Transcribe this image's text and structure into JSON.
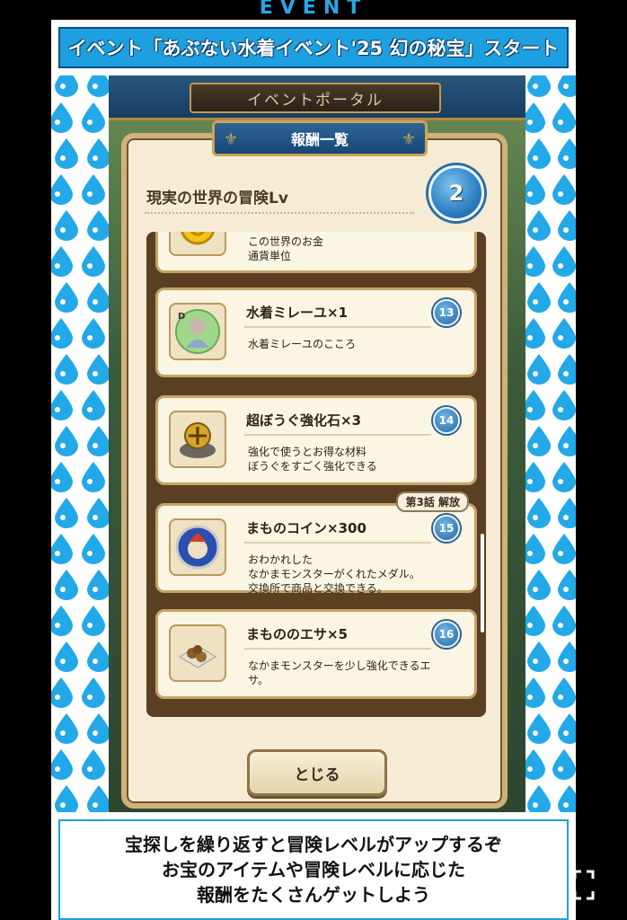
{
  "header": {
    "event_label": "EVENT",
    "banner_text": "イベント「あぶない水着イベント'25 幻の秘宝」スタート"
  },
  "game": {
    "portal_title": "イベントポータル",
    "dialog": {
      "title": "報酬一覧",
      "heading": "現実の世界の冒険Lv",
      "current_level": "2",
      "rewards": [
        {
          "name": "",
          "level": "",
          "desc_lines": [
            "この世界のお金",
            "通貨単位"
          ],
          "icon": "gold-coin-icon"
        },
        {
          "name": "水着ミレーユ×1",
          "level": "13",
          "desc_lines": [
            "水着ミレーユのこころ"
          ],
          "icon": "heart-card-icon"
        },
        {
          "name": "超ぼうぐ強化石×3",
          "level": "14",
          "desc_lines": [
            "強化で使うとお得な材料",
            "ぼうぐをすごく強化できる"
          ],
          "icon": "enhance-stone-icon"
        },
        {
          "name": "まものコイン×300",
          "level": "15",
          "tag": "第3話 解放",
          "desc_lines": [
            "おわかれした",
            "なかまモンスターがくれたメダル。",
            "交換所で商品と交換できる。"
          ],
          "icon": "monster-coin-icon"
        },
        {
          "name": "まもののエサ×5",
          "level": "16",
          "desc_lines": [
            "なかまモンスターを少し強化できるエ",
            "サ。"
          ],
          "icon": "monster-food-icon"
        }
      ],
      "close_label": "とじる"
    }
  },
  "caption": {
    "lines": [
      "宝探しを繰り返すと冒険レベルがアップするぞ",
      "お宝のアイテムや冒険レベルに応じた",
      "報酬をたくさんゲットしよう"
    ]
  },
  "colors": {
    "accent": "#1ea0e0",
    "panel": "#f6ecd5",
    "frame": "#cfb27a"
  }
}
